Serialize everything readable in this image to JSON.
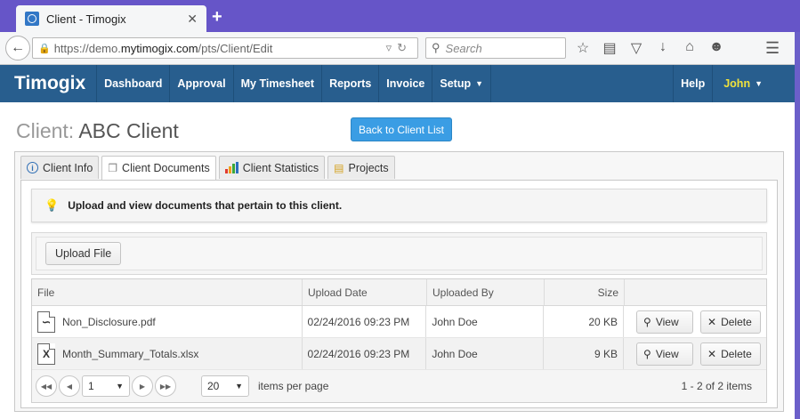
{
  "browser": {
    "tab_title": "Client - Timogix",
    "tab_close": "✕",
    "new_tab": "+",
    "url_prefix": "https://demo.",
    "url_domain": "mytimogix.com",
    "url_path": "/pts/Client/Edit",
    "search_placeholder": "Search",
    "icons": [
      "star-icon",
      "reading-list-icon",
      "pocket-icon",
      "download-icon",
      "home-icon",
      "smiley-icon",
      "menu-icon"
    ]
  },
  "app": {
    "brand": "Timogix",
    "nav": [
      "Dashboard",
      "Approval",
      "My Timesheet",
      "Reports",
      "Invoice",
      "Setup"
    ],
    "help": "Help",
    "user": "John",
    "colors": {
      "nav_bg": "#285e8e",
      "user": "#f0e23c",
      "primary_button": "#3a9de4"
    }
  },
  "page": {
    "heading_label": "Client:",
    "client_name": "ABC Client",
    "back_button": "Back to Client List",
    "tabs": [
      "Client Info",
      "Client Documents",
      "Client Statistics",
      "Projects"
    ],
    "active_tab": "Client Documents",
    "notice": "Upload and view documents that pertain to this client.",
    "upload_button": "Upload File"
  },
  "grid": {
    "columns": [
      "File",
      "Upload Date",
      "Uploaded By",
      "Size",
      ""
    ],
    "rows": [
      {
        "file": "Non_Disclosure.pdf",
        "icon": "pdf-icon",
        "date": "02/24/2016 09:23 PM",
        "by": "John Doe",
        "size": "20 KB"
      },
      {
        "file": "Month_Summary_Totals.xlsx",
        "icon": "excel-icon",
        "date": "02/24/2016 09:23 PM",
        "by": "John Doe",
        "size": "9 KB"
      }
    ],
    "view_label": "View",
    "delete_label": "Delete",
    "pager": {
      "page": "1",
      "page_size": "20",
      "per_page_text": "items per page",
      "info": "1 - 2 of 2 items"
    }
  }
}
